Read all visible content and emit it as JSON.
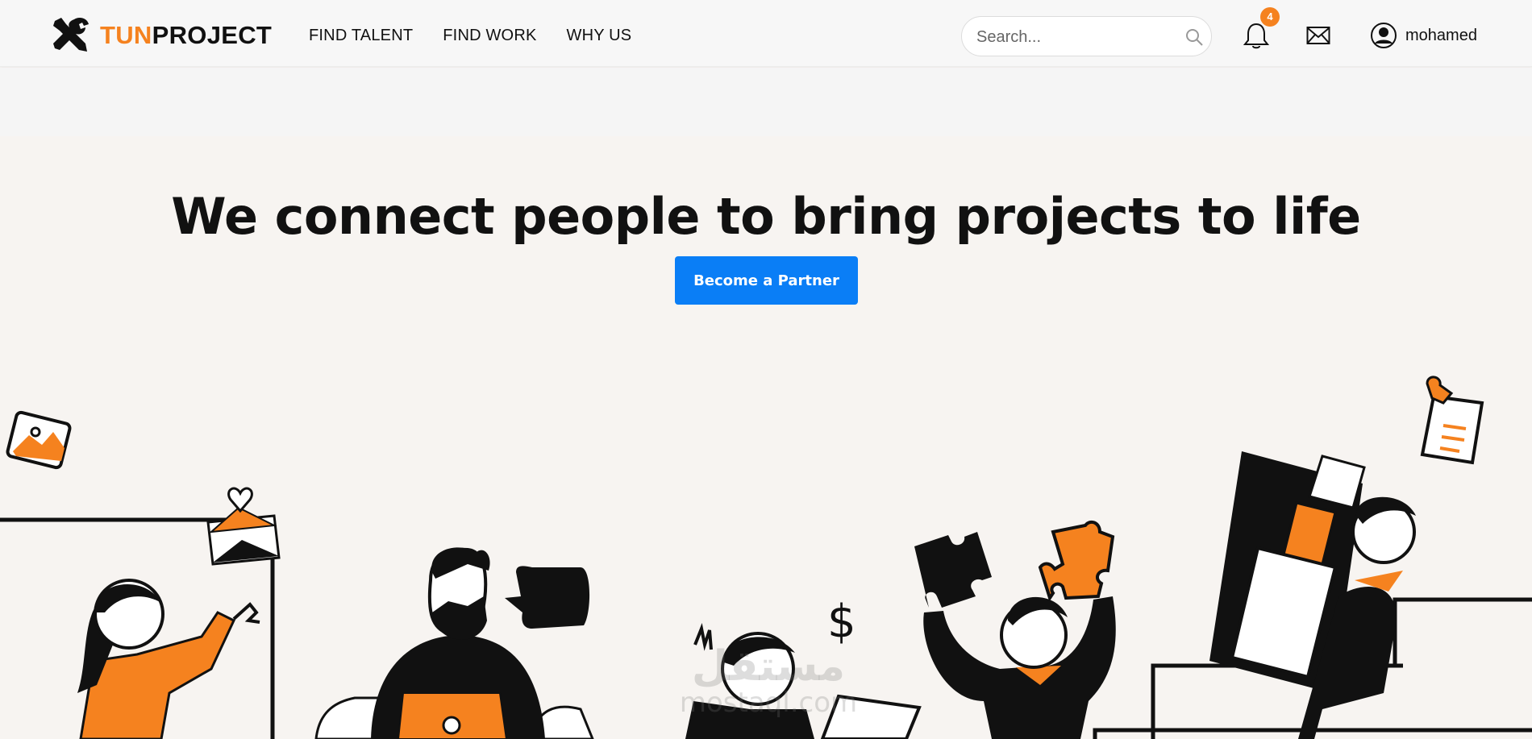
{
  "brand": {
    "part1": "TUN",
    "part2": "PROJECT",
    "accent": "#f5821f",
    "icon": "tools-icon"
  },
  "nav": {
    "items": [
      {
        "label": "FIND TALENT"
      },
      {
        "label": "FIND WORK"
      },
      {
        "label": "WHY US"
      }
    ]
  },
  "search": {
    "placeholder": "Search...",
    "icon": "search-icon"
  },
  "notifications": {
    "count": "4",
    "icon": "bell-icon"
  },
  "messages": {
    "icon": "mail-icon"
  },
  "user": {
    "name": "mohamed",
    "icon": "user-circle-icon"
  },
  "hero": {
    "title": "We connect people to bring projects to life",
    "cta_label": "Become a Partner",
    "cta_color": "#0a7ef6"
  },
  "watermark": {
    "line1": "مستقل",
    "line2": "mostaql.com"
  }
}
